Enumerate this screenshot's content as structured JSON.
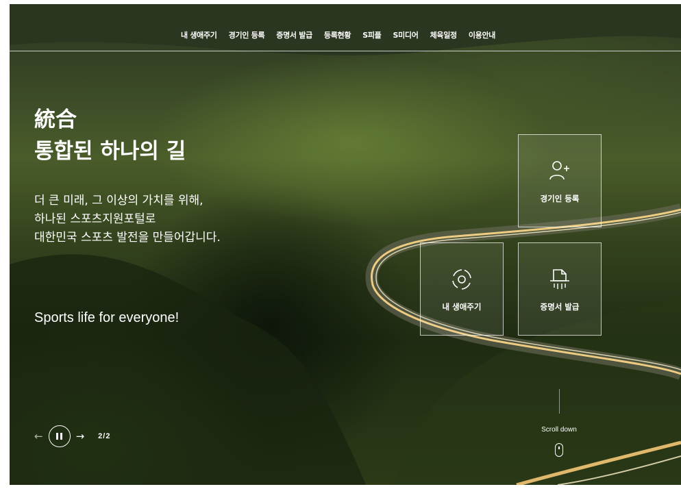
{
  "nav": {
    "items": [
      "내 생애주기",
      "경기인 등록",
      "증명서 발급",
      "등록현황",
      "S피플",
      "S미디어",
      "체육일정",
      "이용안내"
    ]
  },
  "hero": {
    "title_line1": "統合",
    "title_line2": "통합된 하나의 길",
    "desc_line1": "더 큰 미래, 그 이상의 가치를 위해,",
    "desc_line2": "하나된 스포츠지원포털로",
    "desc_line3": "대한민국 스포츠 발전을 만들어갑니다.",
    "tagline": "Sports life for everyone!"
  },
  "quick_cards": [
    {
      "label": "경기인 등록",
      "icon": "user-plus-icon"
    },
    {
      "label": "내 생애주기",
      "icon": "lifecycle-icon"
    },
    {
      "label": "증명서 발급",
      "icon": "certificate-print-icon"
    }
  ],
  "slider": {
    "page": "2/2"
  },
  "scroll": {
    "label": "Scroll down"
  },
  "colors": {
    "text": "#ffffff",
    "card_border": "rgba(255,255,255,0.7)"
  }
}
